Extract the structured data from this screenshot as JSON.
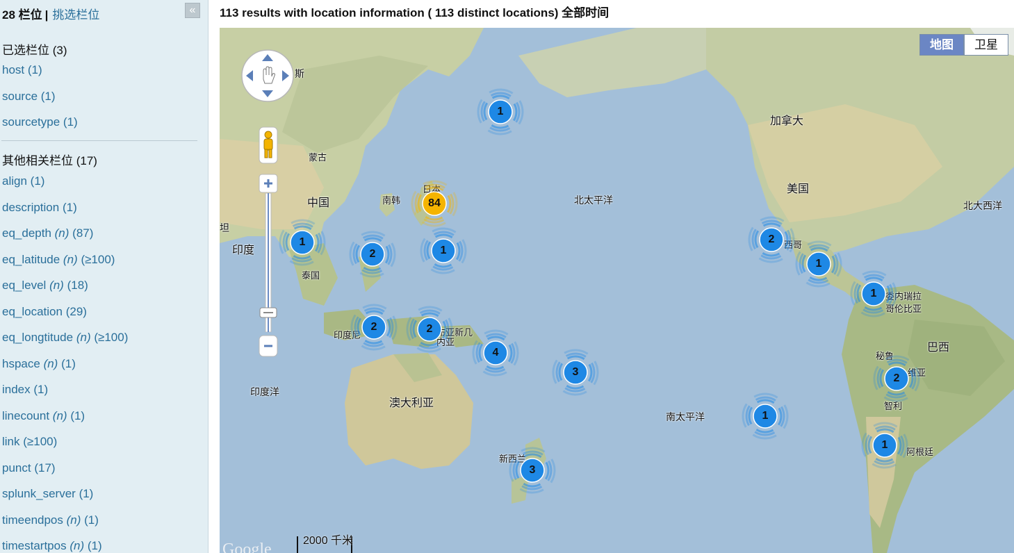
{
  "sidebar": {
    "header": {
      "count": "28 栏位",
      "separator": "|",
      "pick_link": "挑选栏位",
      "collapse_icon": "«"
    },
    "selected_title": "已选栏位 (3)",
    "selected": [
      {
        "name": "host",
        "modifier": "",
        "count": "(1)"
      },
      {
        "name": "source",
        "modifier": "",
        "count": "(1)"
      },
      {
        "name": "sourcetype",
        "modifier": "",
        "count": "(1)"
      }
    ],
    "other_title": "其他相关栏位 (17)",
    "other": [
      {
        "name": "align",
        "modifier": "",
        "count": "(1)"
      },
      {
        "name": "description",
        "modifier": "",
        "count": "(1)"
      },
      {
        "name": "eq_depth",
        "modifier": "(n)",
        "count": "(87)"
      },
      {
        "name": "eq_latitude",
        "modifier": "(n)",
        "count": "(≥100)"
      },
      {
        "name": "eq_level",
        "modifier": "(n)",
        "count": "(18)"
      },
      {
        "name": "eq_location",
        "modifier": "",
        "count": "(29)"
      },
      {
        "name": "eq_longtitude",
        "modifier": "(n)",
        "count": "(≥100)"
      },
      {
        "name": "hspace",
        "modifier": "(n)",
        "count": "(1)"
      },
      {
        "name": "index",
        "modifier": "",
        "count": "(1)"
      },
      {
        "name": "linecount",
        "modifier": "(n)",
        "count": "(1)"
      },
      {
        "name": "link",
        "modifier": "",
        "count": "(≥100)"
      },
      {
        "name": "punct",
        "modifier": "",
        "count": "(17)"
      },
      {
        "name": "splunk_server",
        "modifier": "",
        "count": "(1)"
      },
      {
        "name": "timeendpos",
        "modifier": "(n)",
        "count": "(1)"
      },
      {
        "name": "timestartpos",
        "modifier": "(n)",
        "count": "(1)"
      }
    ]
  },
  "results_header": "113 results with location information ( 113 distinct locations) 全部时间",
  "map": {
    "map_type_active": "地图",
    "map_type_inactive": "卫星",
    "scale_label": "2000 千米",
    "google_logo": "Google",
    "labels": {
      "russia_fragment": "斯",
      "mongolia": "蒙古",
      "china": "中国",
      "south_korea": "南韩",
      "japan": "日本",
      "india": "印度",
      "thailand": "泰国",
      "indonesia": "印度尼",
      "papua": "布亚新几内亚",
      "indian_ocean": "印度洋",
      "australia": "澳大利亚",
      "new_zealand": "新西兰",
      "north_pacific": "北太平洋",
      "south_pacific": "南太平洋",
      "canada": "加拿大",
      "usa": "美国",
      "mexico": "西哥",
      "venezuela": "委内瑞拉",
      "colombia": "哥伦比亚",
      "brazil": "巴西",
      "peru": "秘鲁",
      "bolivia": "维亚",
      "chile": "智利",
      "argentina": "阿根廷",
      "north_atlantic": "北大西洋",
      "pakistan_fragment": "坦"
    },
    "clusters": [
      {
        "id": "kamchatka",
        "count": "1",
        "color": "#1e88e5"
      },
      {
        "id": "japan",
        "count": "84",
        "color": "#f5b400"
      },
      {
        "id": "myanmar",
        "count": "1",
        "color": "#1e88e5"
      },
      {
        "id": "philippines",
        "count": "2",
        "color": "#1e88e5"
      },
      {
        "id": "marianas",
        "count": "1",
        "color": "#1e88e5"
      },
      {
        "id": "sumatra",
        "count": "2",
        "color": "#1e88e5"
      },
      {
        "id": "papua",
        "count": "2",
        "color": "#1e88e5"
      },
      {
        "id": "solomon",
        "count": "4",
        "color": "#1e88e5"
      },
      {
        "id": "fiji",
        "count": "3",
        "color": "#1e88e5"
      },
      {
        "id": "new-zealand",
        "count": "3",
        "color": "#1e88e5"
      },
      {
        "id": "mexico",
        "count": "2",
        "color": "#1e88e5"
      },
      {
        "id": "central-america",
        "count": "1",
        "color": "#1e88e5"
      },
      {
        "id": "colombia",
        "count": "1",
        "color": "#1e88e5"
      },
      {
        "id": "east-pacific",
        "count": "1",
        "color": "#1e88e5"
      },
      {
        "id": "bolivia",
        "count": "2",
        "color": "#1e88e5"
      },
      {
        "id": "argentina",
        "count": "1",
        "color": "#1e88e5"
      }
    ]
  }
}
